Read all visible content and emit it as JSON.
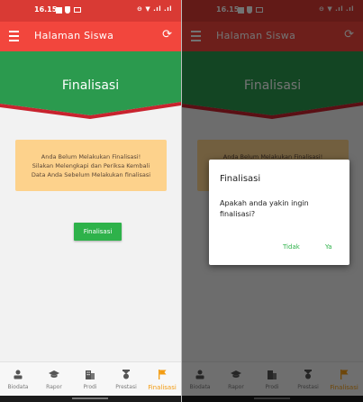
{
  "status": {
    "time": "16.15",
    "system": "⊖ ▼ .ıl .ıl"
  },
  "appbar": {
    "title": "Halaman Siswa"
  },
  "hero": {
    "title": "Finalisasi"
  },
  "notice": {
    "lines": [
      "Anda Belum Melakukan Finalisasi!",
      "Silakan Melengkapi dan Periksa Kembali",
      "Data Anda Sebelum Melakukan finalisasi"
    ]
  },
  "finalize_button": "Finalisasi",
  "nav": [
    {
      "label": "Biodata",
      "icon": "person-icon"
    },
    {
      "label": "Rapor",
      "icon": "graduation-cap-icon"
    },
    {
      "label": "Prodi",
      "icon": "building-icon"
    },
    {
      "label": "Prestasi",
      "icon": "medal-icon"
    },
    {
      "label": "Finalisasi",
      "icon": "flag-icon",
      "active": true
    }
  ],
  "dialog": {
    "title": "Finalisasi",
    "message": "Apakah anda yakin ingin finalisasi?",
    "cancel": "Tidak",
    "confirm": "Ya"
  },
  "colors": {
    "status_bar": "#d93a34",
    "app_bar": "#f2463d",
    "hero_green": "#2b9a4e",
    "hero_stripe": "#c8232e",
    "notice": "#fdd28c",
    "button_green": "#2eb24a",
    "active_nav": "#f39c12"
  }
}
